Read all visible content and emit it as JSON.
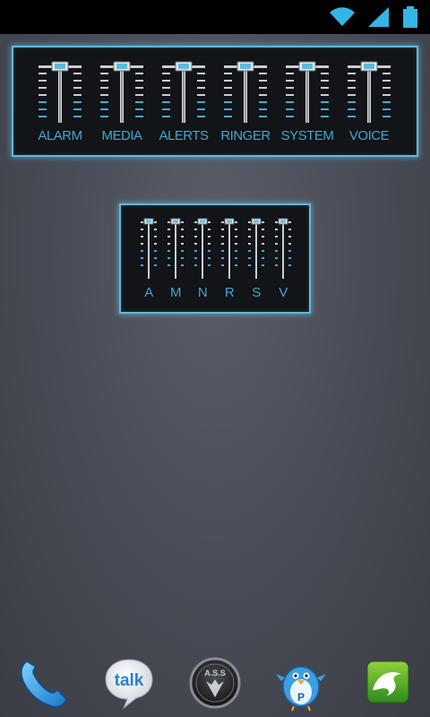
{
  "status_bar": {
    "icons": [
      "wifi-icon",
      "signal-icon",
      "battery-icon"
    ],
    "accent_color": "#33b5e5"
  },
  "widgets": {
    "large": {
      "labels": [
        "ALARM",
        "MEDIA",
        "ALERTS",
        "RINGER",
        "SYSTEM",
        "VOICE"
      ]
    },
    "small": {
      "labels": [
        "A",
        "M",
        "N",
        "R",
        "S",
        "V"
      ]
    },
    "accent_color": "#43a6d1",
    "border_color": "#5fb9dc"
  },
  "dock": {
    "apps": [
      {
        "icon": "phone-icon"
      },
      {
        "icon": "talk-icon",
        "label": "talk"
      },
      {
        "icon": "app-badge-icon",
        "label": "A.S.S"
      },
      {
        "icon": "bird-p-icon",
        "label": "P"
      },
      {
        "icon": "dolphin-browser-icon"
      }
    ]
  }
}
